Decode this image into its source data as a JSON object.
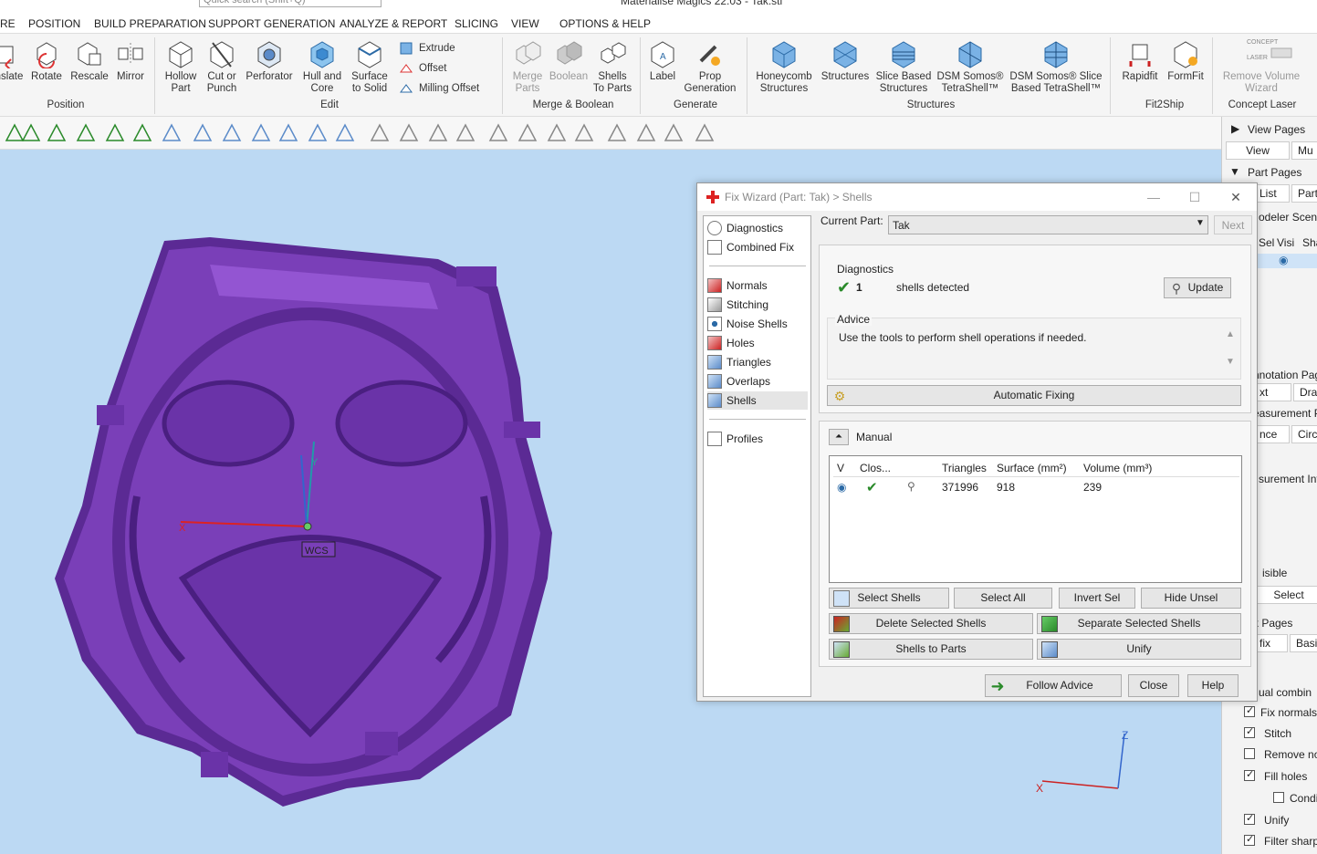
{
  "app": {
    "title": "Materialise Magics 22.03 - Tak.stl",
    "search_placeholder": "Quick search (Shift+Q)"
  },
  "menu": [
    "RE",
    "POSITION",
    "BUILD PREPARATION",
    "SUPPORT GENERATION",
    "ANALYZE & REPORT",
    "SLICING",
    "VIEW",
    "OPTIONS & HELP"
  ],
  "ribbon": {
    "buttons": [
      "nslate",
      "Rotate",
      "Rescale",
      "Mirror",
      "Hollow\nPart",
      "Cut or\nPunch",
      "Perforator",
      "Hull and\nCore",
      "Surface\nto Solid",
      "Merge\nParts",
      "Boolean",
      "Shells\nTo Parts",
      "Label",
      "Prop\nGeneration",
      "Honeycomb\nStructures",
      "Structures",
      "Slice Based\nStructures",
      "DSM Somos®\nTetraShell™",
      "DSM Somos® Slice\nBased TetraShell™",
      "Rapidfit",
      "FormFit",
      "Remove Volume\nWizard"
    ],
    "small_buttons": [
      "Extrude",
      "Offset",
      "Milling Offset"
    ],
    "groups": [
      "Position",
      "Edit",
      "Merge & Boolean",
      "Generate",
      "Structures",
      "Fit2Ship",
      "Concept Laser"
    ],
    "concept_laser_logo": "CONCEPT\nLASER"
  },
  "viewport": {
    "wcs_label": "WCS",
    "axis_x": "X",
    "axis_y": "Y",
    "axis_z": "Z",
    "bg_color": "#bcd9f3",
    "model_color": "#7a3fb8"
  },
  "dialog": {
    "title": "Fix Wizard (Part: Tak) > Shells",
    "nav": [
      "Diagnostics",
      "Combined Fix",
      "Normals",
      "Stitching",
      "Noise Shells",
      "Holes",
      "Triangles",
      "Overlaps",
      "Shells",
      "Profiles"
    ],
    "current_part_label": "Current Part:",
    "current_part_value": "Tak",
    "next_label": "Next",
    "diagnostics_header": "Diagnostics",
    "shell_count": "1",
    "shell_text": "shells detected",
    "update_label": "Update",
    "advice_header": "Advice",
    "advice_text": "Use the tools to perform shell operations if needed.",
    "automatic_fixing": "Automatic Fixing",
    "manual_header": "Manual",
    "table": {
      "columns": [
        "V",
        "Clos...",
        "",
        "Triangles",
        "Surface (mm²)",
        "Volume (mm³)"
      ],
      "rows": [
        {
          "triangles": "371996",
          "surface": "918",
          "volume": "239"
        }
      ]
    },
    "buttons": {
      "select_shells": "Select Shells",
      "select_all": "Select All",
      "invert_sel": "Invert Sel",
      "hide_unsel": "Hide Unsel",
      "delete_selected": "Delete Selected Shells",
      "separate_selected": "Separate Selected Shells",
      "shells_to_parts": "Shells to Parts",
      "unify": "Unify",
      "follow_advice": "Follow Advice",
      "close": "Close",
      "help": "Help"
    }
  },
  "right_panel": {
    "view_pages": "View Pages",
    "view_tab": "View",
    "mu_tab": "Mu",
    "part_pages": "Part Pages",
    "list_tab": "List",
    "part_tab": "Part I",
    "modeler_scene": "odeler Scene",
    "cols": [
      "Sel",
      "Visi",
      "Sha"
    ],
    "annotation": "nnotation Pag",
    "text_tab": "xt",
    "dr_tab": "Dra",
    "measurement": "easurement P",
    "nce_tab": "nce",
    "circ_tab": "Circl",
    "measurement_info": "surement Info",
    "visible": "isible",
    "select": "Select",
    "fix_pages": "x Pages",
    "fix_tab": "fix",
    "basic_tab": "Basic",
    "manual_combine": "ual combin",
    "options": [
      "Fix normals",
      "Stitch",
      "Remove nois",
      "Fill holes",
      "Condi",
      "Unify",
      "Filter sharp"
    ]
  }
}
